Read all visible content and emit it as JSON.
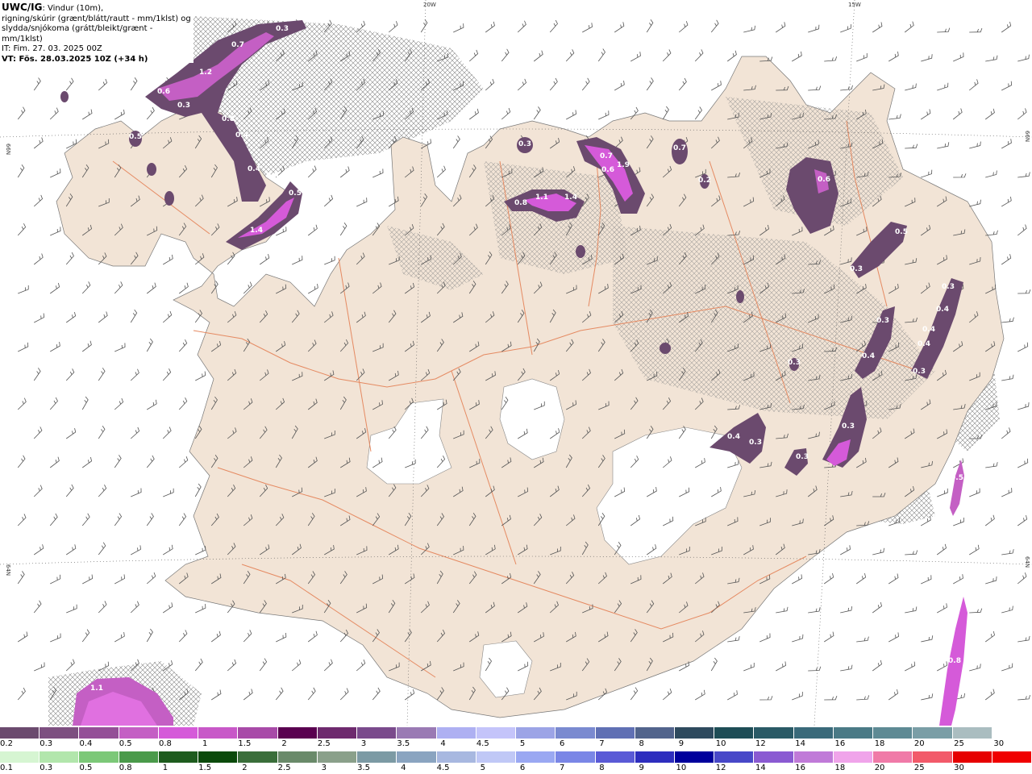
{
  "header": {
    "brand": "UWC/IG",
    "line1": ": Vindur (10m),",
    "line2": "rigning/skúrir (grænt/blátt/rautt - mm/1klst) og",
    "line3": "slydda/snjókoma (grátt/bleikt/grænt - mm/1klst)",
    "line4": "IT: Fim. 27. 03. 2025 00Z",
    "line5": "VT: Fös. 28.03.2025 10Z (+34 h)"
  },
  "grid_labels": {
    "lon_20w": "20W",
    "lon_15w": "15W",
    "lat_66n_left": "66N",
    "lat_66n_right": "66N",
    "lat_64n_left": "64N",
    "lat_64n_right": "64N"
  },
  "precip_labels": [
    "0.3",
    "0.7",
    "1.2",
    "0.6",
    "0.3",
    "0.8",
    "0.4",
    "0.4",
    "0.4",
    "0.5",
    "1.4",
    "0.5",
    "0.3",
    "1.1",
    "1.4",
    "0.8",
    "0.7",
    "1.9",
    "0.6",
    "0.7",
    "0.2",
    "0.6",
    "0.5",
    "0.3",
    "0.3",
    "0.4",
    "0.3",
    "0.4",
    "0.4",
    "0.3",
    "0.4",
    "0.3",
    "0.4",
    "0.3",
    "0.3",
    "0.5",
    "0.8",
    "1.1",
    "0.3"
  ],
  "legend_snow": {
    "ticks": [
      "0.2",
      "0.3",
      "0.4",
      "0.5",
      "0.8",
      "1",
      "1.5",
      "2",
      "2.5",
      "3",
      "3.5",
      "4",
      "4.5",
      "5",
      "6",
      "7",
      "8",
      "9",
      "10",
      "12",
      "14",
      "16",
      "18",
      "20",
      "25",
      "30"
    ],
    "colors": [
      "#6b4a6e",
      "#7d4f80",
      "#944f97",
      "#c45fc4",
      "#d55ad9",
      "#c858c8",
      "#a84aa8",
      "#5a0050",
      "#6e2a6e",
      "#7a4a8c",
      "#9a7ab4",
      "#aeb0f2",
      "#c4c4fa",
      "#9ca4e6",
      "#7a8ad0",
      "#6070b4",
      "#52648c",
      "#2e4a5e",
      "#1e4d56",
      "#2a5a66",
      "#3a6a7a",
      "#4a7a86",
      "#5e8a94",
      "#7a9ea6",
      "#aabdc0",
      "#ffffff"
    ]
  },
  "legend_rain": {
    "ticks": [
      "0.1",
      "0.3",
      "0.5",
      "0.8",
      "1",
      "1.5",
      "2",
      "2.5",
      "3",
      "3.5",
      "4",
      "4.5",
      "5",
      "6",
      "7",
      "8",
      "9",
      "10",
      "12",
      "14",
      "16",
      "18",
      "20",
      "25",
      "30"
    ],
    "colors": [
      "#d6f5d2",
      "#b2e6ac",
      "#7cc878",
      "#4a9a4a",
      "#1e5c1e",
      "#0b4a0b",
      "#3a6e3a",
      "#6a8a6a",
      "#8aa08a",
      "#7c9aa4",
      "#8aa4c0",
      "#a8b8e0",
      "#c0c8f6",
      "#9aa8f2",
      "#7a86e6",
      "#5a5ad6",
      "#2e2ebe",
      "#00009c",
      "#4848c8",
      "#8a5ad2",
      "#c07ad8",
      "#f0a4ea",
      "#f07aa8",
      "#f25a6a",
      "#e60000",
      "#f00000"
    ]
  }
}
